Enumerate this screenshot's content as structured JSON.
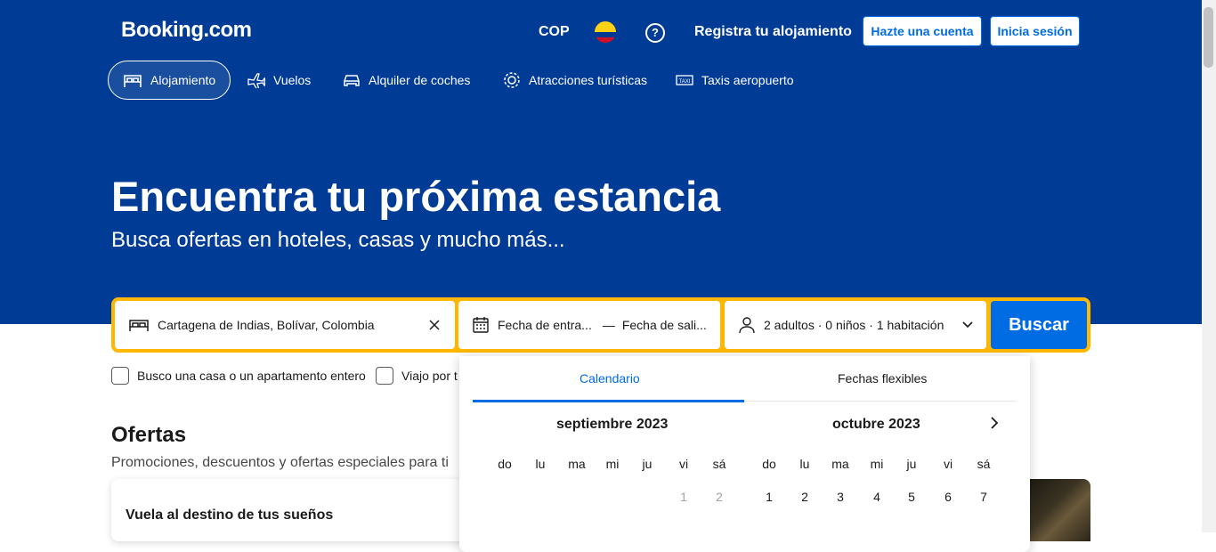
{
  "header": {
    "logo": "Booking.com",
    "currency": "COP",
    "registra": "Registra tu alojamiento",
    "signup": "Hazte una cuenta",
    "login": "Inicia sesión"
  },
  "nav": [
    {
      "label": "Alojamiento",
      "icon": "bed-icon",
      "active": true
    },
    {
      "label": "Vuelos",
      "icon": "plane-icon"
    },
    {
      "label": "Alquiler de coches",
      "icon": "car-icon"
    },
    {
      "label": "Atracciones turísticas",
      "icon": "attractions-icon"
    },
    {
      "label": "Taxis aeropuerto",
      "icon": "taxi-icon"
    }
  ],
  "hero": {
    "title": "Encuentra tu próxima estancia",
    "subtitle": "Busca ofertas en hoteles, casas y mucho más..."
  },
  "search": {
    "destination": "Cartagena de Indias, Bolívar, Colombia",
    "checkin": "Fecha de entra...",
    "separator": "—",
    "checkout": "Fecha de sali...",
    "guests": "2 adultos · 0 niños · 1 habitación",
    "button": "Buscar"
  },
  "checks": {
    "entire_home": "Busco una casa o un apartamento entero",
    "work_trip": "Viajo por t"
  },
  "offers": {
    "title": "Ofertas",
    "subtitle": "Promociones, descuentos y ofertas especiales para ti",
    "card_title": "Vuela al destino de tus sueños"
  },
  "calendar": {
    "tab_calendar": "Calendario",
    "tab_flexible": "Fechas flexibles",
    "month1": "septiembre 2023",
    "month2": "octubre 2023",
    "weekdays": [
      "do",
      "lu",
      "ma",
      "mi",
      "ju",
      "vi",
      "sá"
    ],
    "month1_days": [
      "1",
      "2"
    ],
    "month2_days": [
      "1",
      "2",
      "3",
      "4",
      "5",
      "6",
      "7"
    ]
  },
  "colors": {
    "brand_blue": "#003b95",
    "accent_blue": "#006ce4",
    "search_border": "#ffb700"
  }
}
